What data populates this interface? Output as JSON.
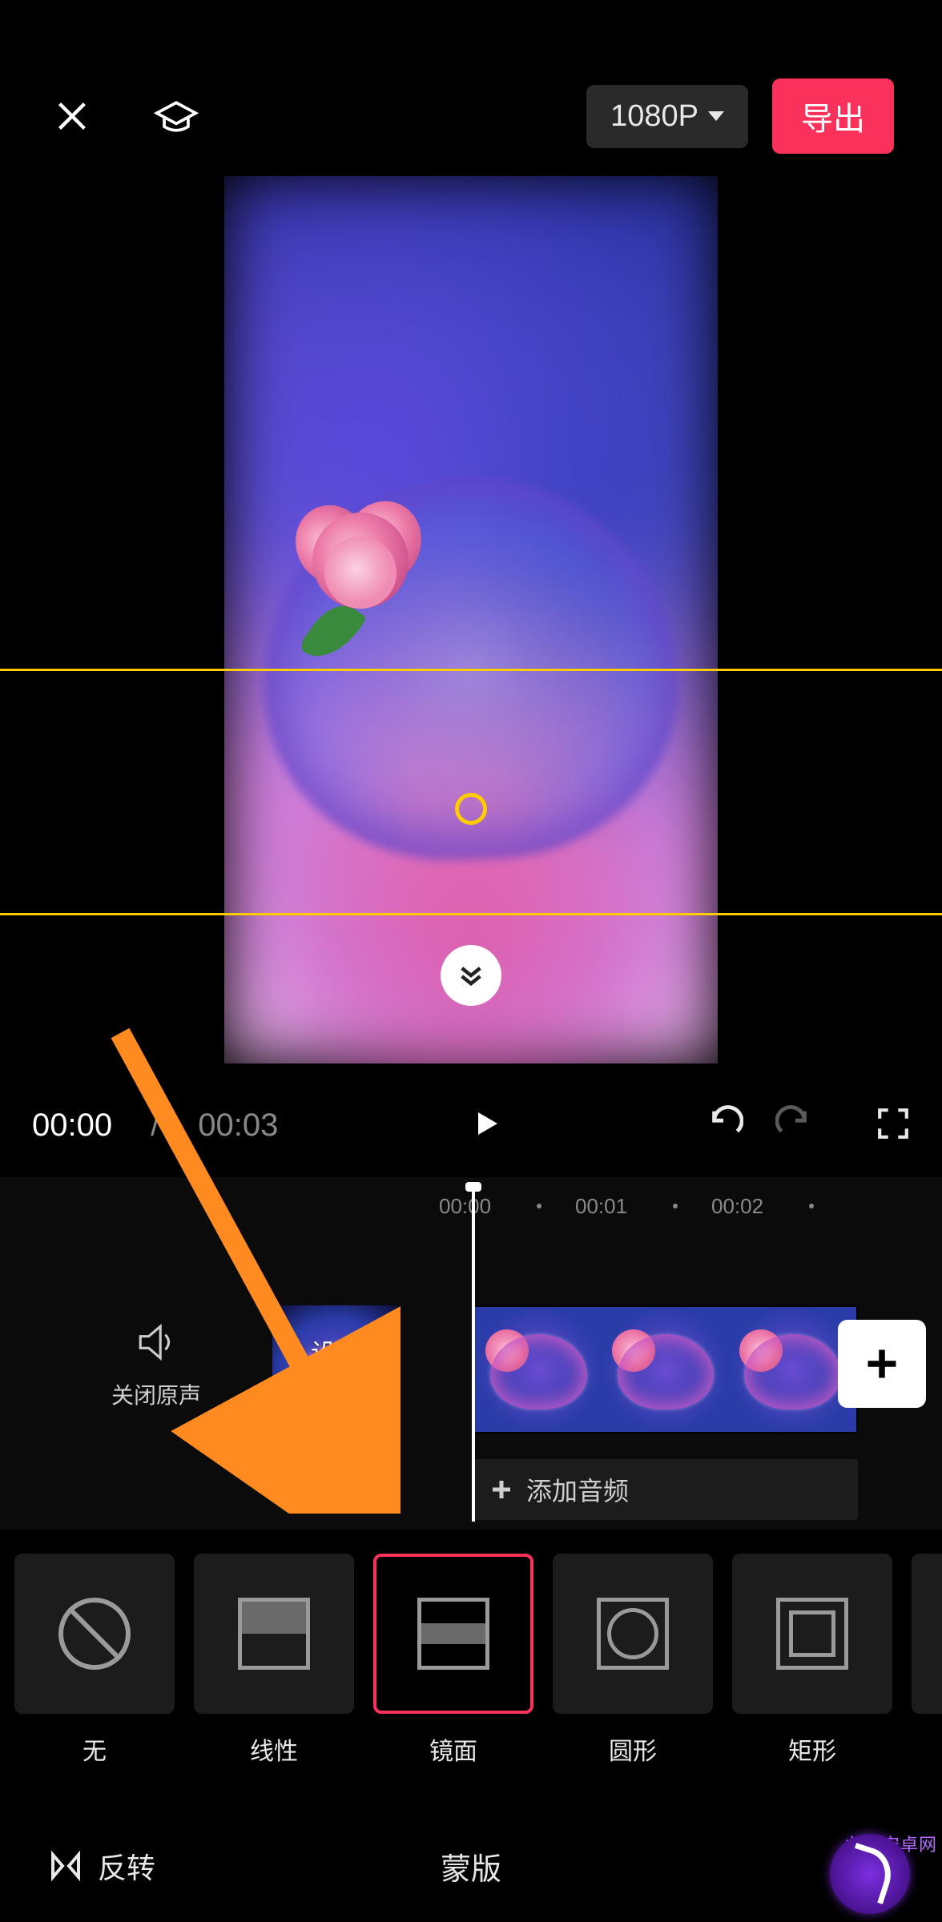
{
  "topbar": {
    "resolution": "1080P",
    "export": "导出"
  },
  "playback": {
    "current": "00:00",
    "separator": "/",
    "total": "00:03"
  },
  "ruler": {
    "marks": [
      "00:00",
      "00:01",
      "00:02"
    ]
  },
  "timeline": {
    "mute_label": "关闭原声",
    "cover_label": "设置\n封面",
    "add_audio": "添加音频"
  },
  "mask": {
    "items": [
      {
        "key": "none",
        "label": "无"
      },
      {
        "key": "linear",
        "label": "线性"
      },
      {
        "key": "mirror",
        "label": "镜面"
      },
      {
        "key": "circle",
        "label": "圆形"
      },
      {
        "key": "rect",
        "label": "矩形"
      }
    ],
    "selected": "mirror"
  },
  "bottombar": {
    "invert": "反转",
    "title": "蒙版"
  },
  "watermark": {
    "name": "龙城安卓网"
  }
}
